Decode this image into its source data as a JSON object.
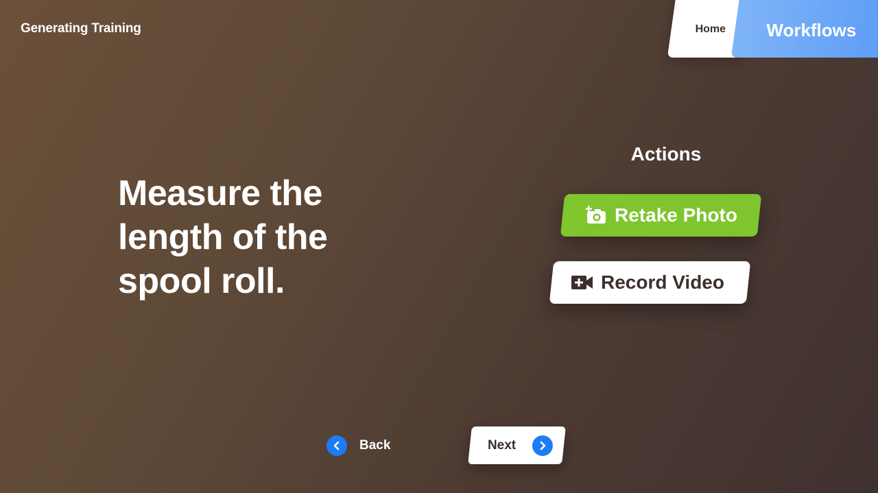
{
  "header": {
    "app_title": "Generating Training",
    "tabs": [
      {
        "label": "Home"
      },
      {
        "label": "Workflows"
      }
    ]
  },
  "step": {
    "instruction": "Measure the length of the spool roll."
  },
  "actions": {
    "heading": "Actions",
    "buttons": [
      {
        "label": "Retake Photo",
        "icon": "add-photo-icon",
        "color": "#7ec52e"
      },
      {
        "label": "Record Video",
        "icon": "add-video-icon",
        "color": "#ffffff"
      }
    ]
  },
  "navigation": {
    "back_label": "Back",
    "next_label": "Next",
    "accent": "#1e7cf2"
  },
  "colors": {
    "workflows_tab": "#6aa7f7",
    "text_dark": "#3b2f2c"
  }
}
